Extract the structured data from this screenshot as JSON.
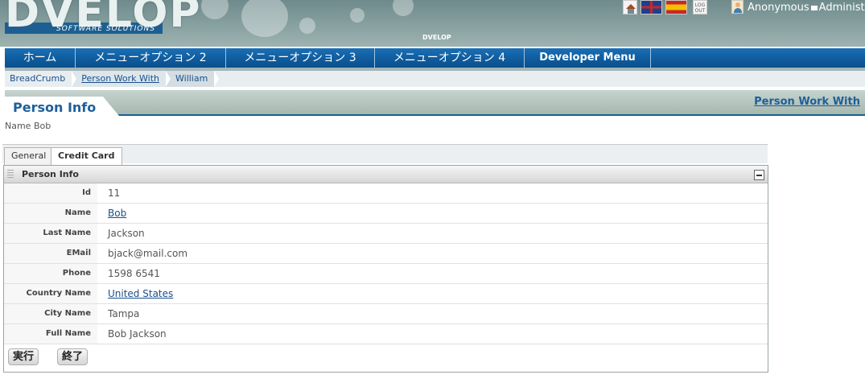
{
  "header": {
    "logo_text": "DVELOP",
    "logo_subtitle": "SOFTWARE SOLUTIONS",
    "mini_logo": "DVELOP",
    "logout_label": "LOG OUT",
    "user_name": "Anonymous",
    "user_role": "Administ"
  },
  "nav": {
    "items": [
      {
        "label": "ホーム"
      },
      {
        "label": "メニューオプション 2"
      },
      {
        "label": "メニューオプション 3"
      },
      {
        "label": "メニューオプション 4"
      },
      {
        "label": "Developer Menu"
      }
    ]
  },
  "breadcrumb": {
    "items": [
      "BreadCrumb",
      "Person Work With",
      "William"
    ]
  },
  "page": {
    "title": "Person Info",
    "right_link": "Person Work With",
    "name_line": "Name Bob"
  },
  "tabs": [
    "General",
    "Credit Card"
  ],
  "panel": {
    "title": "Person Info",
    "fields": [
      {
        "label": "Id",
        "value": "11"
      },
      {
        "label": "Name",
        "value": "Bob"
      },
      {
        "label": "Last Name",
        "value": "Jackson"
      },
      {
        "label": "EMail",
        "value": "bjack@mail.com"
      },
      {
        "label": "Phone",
        "value": "1598 6541"
      },
      {
        "label": "Country Name",
        "value": "United States"
      },
      {
        "label": "City Name",
        "value": "Tampa"
      },
      {
        "label": "Full Name",
        "value": "Bob Jackson"
      }
    ]
  },
  "buttons": {
    "execute": "実行",
    "close": "終了"
  }
}
